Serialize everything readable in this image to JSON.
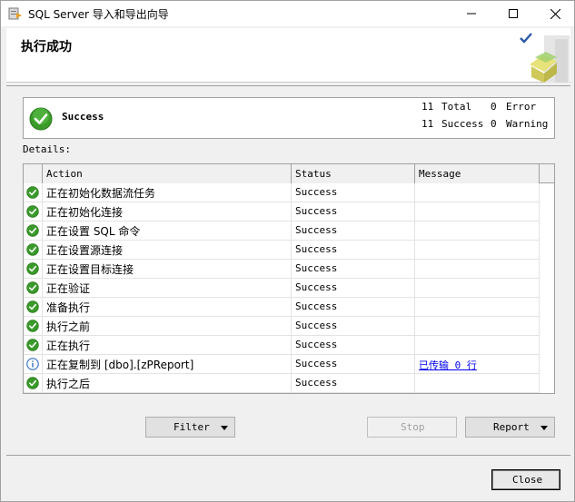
{
  "window": {
    "title": "SQL Server 导入和导出向导"
  },
  "header": {
    "title": "执行成功"
  },
  "summary": {
    "status": "Success",
    "total_count": "11",
    "total_label": "Total",
    "success_count": "11",
    "success_label": "Success",
    "error_count": "0",
    "error_label": "Error",
    "warning_count": "0",
    "warning_label": "Warning"
  },
  "details_label": "Details:",
  "grid": {
    "columns": {
      "action": "Action",
      "status": "Status",
      "message": "Message"
    },
    "rows": [
      {
        "icon": "success-icon",
        "action": "正在初始化数据流任务",
        "status": "Success",
        "message": ""
      },
      {
        "icon": "success-icon",
        "action": "正在初始化连接",
        "status": "Success",
        "message": ""
      },
      {
        "icon": "success-icon",
        "action": "正在设置 SQL 命令",
        "status": "Success",
        "message": ""
      },
      {
        "icon": "success-icon",
        "action": "正在设置源连接",
        "status": "Success",
        "message": ""
      },
      {
        "icon": "success-icon",
        "action": "正在设置目标连接",
        "status": "Success",
        "message": ""
      },
      {
        "icon": "success-icon",
        "action": "正在验证",
        "status": "Success",
        "message": ""
      },
      {
        "icon": "success-icon",
        "action": "准备执行",
        "status": "Success",
        "message": ""
      },
      {
        "icon": "success-icon",
        "action": "执行之前",
        "status": "Success",
        "message": ""
      },
      {
        "icon": "success-icon",
        "action": "正在执行",
        "status": "Success",
        "message": ""
      },
      {
        "icon": "info-icon",
        "action": "正在复制到 [dbo].[zPReport]",
        "status": "Success",
        "message": "已传输 0 行"
      },
      {
        "icon": "success-icon",
        "action": "执行之后",
        "status": "Success",
        "message": ""
      }
    ]
  },
  "buttons": {
    "filter": "Filter",
    "stop": "Stop",
    "report": "Report",
    "close": "Close"
  },
  "colors": {
    "success_green": "#3a9a2a",
    "info_blue": "#2c6cc4",
    "link": "#0000ee"
  }
}
